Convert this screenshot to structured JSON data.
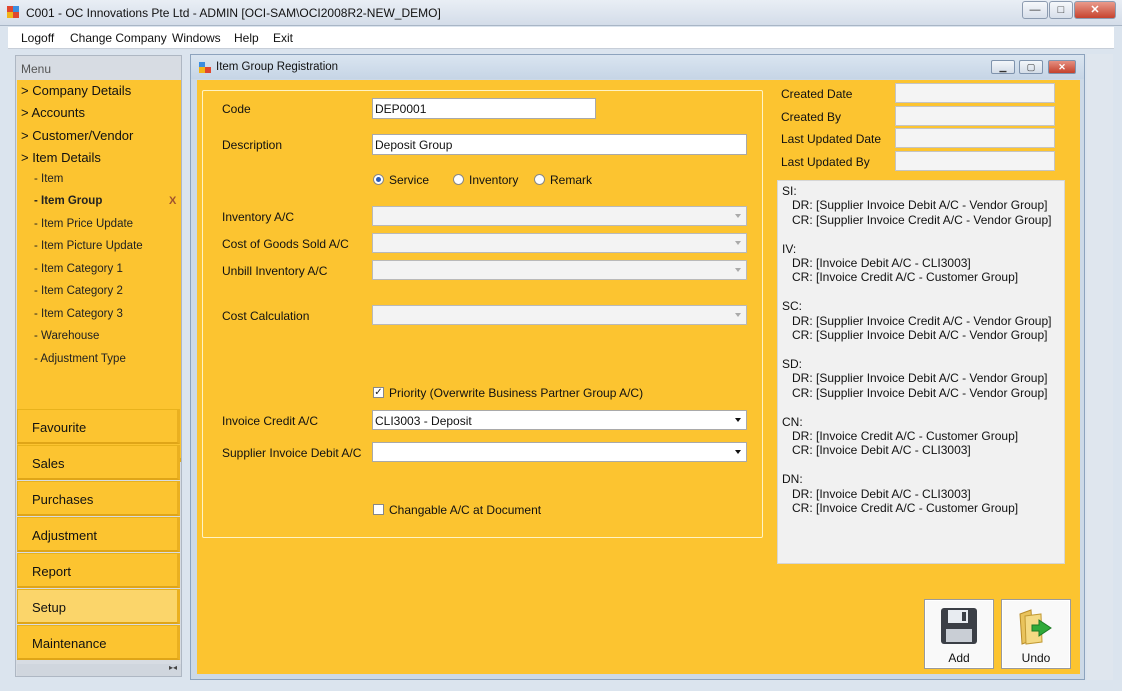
{
  "window": {
    "title": "C001 - OC Innovations Pte Ltd - ADMIN [OCI-SAM\\OCI2008R2-NEW_DEMO]",
    "minimize_glyph": "—",
    "maximize_glyph": "□",
    "close_glyph": "✕"
  },
  "menubar": {
    "logoff": "Logoff",
    "change_company": "Change Company",
    "windows": "Windows",
    "help": "Help",
    "exit": "Exit"
  },
  "sidebar": {
    "header": "Menu",
    "tree": [
      {
        "label": "> Company Details"
      },
      {
        "label": "> Accounts"
      },
      {
        "label": "> Customer/Vendor"
      },
      {
        "label": "> Item Details"
      }
    ],
    "subitems": [
      {
        "label": "- Item"
      },
      {
        "label": "- Item Group"
      },
      {
        "label": "- Item Price Update"
      },
      {
        "label": "- Item Picture Update"
      },
      {
        "label": "- Item Category 1"
      },
      {
        "label": "- Item Category 2"
      },
      {
        "label": "- Item Category 3"
      },
      {
        "label": "- Warehouse"
      },
      {
        "label": "- Adjustment Type"
      }
    ],
    "selected_close": "X",
    "categories": [
      {
        "label": "Favourite"
      },
      {
        "label": "Sales"
      },
      {
        "label": "Purchases"
      },
      {
        "label": "Adjustment"
      },
      {
        "label": "Report"
      },
      {
        "label": "Setup"
      },
      {
        "label": "Maintenance"
      }
    ],
    "footer_glyph": "▸◂"
  },
  "child": {
    "title": "Item Group Registration"
  },
  "form": {
    "code_label": "Code",
    "code_value": "DEP0001",
    "description_label": "Description",
    "description_value": "Deposit Group",
    "radio_service": "Service",
    "radio_inventory": "Inventory",
    "radio_remark": "Remark",
    "inventory_ac_label": "Inventory A/C",
    "cogs_ac_label": "Cost of Goods Sold A/C",
    "unbill_inventory_label": "Unbill Inventory A/C",
    "cost_calc_label": "Cost Calculation",
    "priority_label": "Priority (Overwrite Business Partner Group A/C)",
    "priority_mark": "✓",
    "invoice_credit_label": "Invoice Credit A/C",
    "invoice_credit_value": "CLI3003 - Deposit",
    "supplier_invoice_debit_label": "Supplier Invoice Debit A/C",
    "supplier_invoice_debit_value": "",
    "changable_label": "Changable A/C at Document"
  },
  "info": {
    "created_date_label": "Created Date",
    "created_by_label": "Created By",
    "last_updated_date_label": "Last Updated Date",
    "last_updated_by_label": "Last Updated By"
  },
  "posting_text": "SI:\n   DR: [Supplier Invoice Debit A/C - Vendor Group]\n   CR: [Supplier Invoice Credit A/C - Vendor Group]\n\nIV:\n   DR: [Invoice Debit A/C - CLI3003]\n   CR: [Invoice Credit A/C - Customer Group]\n\nSC:\n   DR: [Supplier Invoice Credit A/C - Vendor Group]\n   CR: [Supplier Invoice Debit A/C - Vendor Group]\n\nSD:\n   DR: [Supplier Invoice Debit A/C - Vendor Group]\n   CR: [Supplier Invoice Debit A/C - Vendor Group]\n\nCN:\n   DR: [Invoice Credit A/C - Customer Group]\n   CR: [Invoice Debit A/C - CLI3003]\n\nDN:\n   DR: [Invoice Debit A/C - CLI3003]\n   CR: [Invoice Credit A/C - Customer Group]",
  "buttons": {
    "add": "Add",
    "undo": "Undo"
  },
  "colors": {
    "accent": "#fcc430",
    "selected_category": "#fbd56a"
  }
}
